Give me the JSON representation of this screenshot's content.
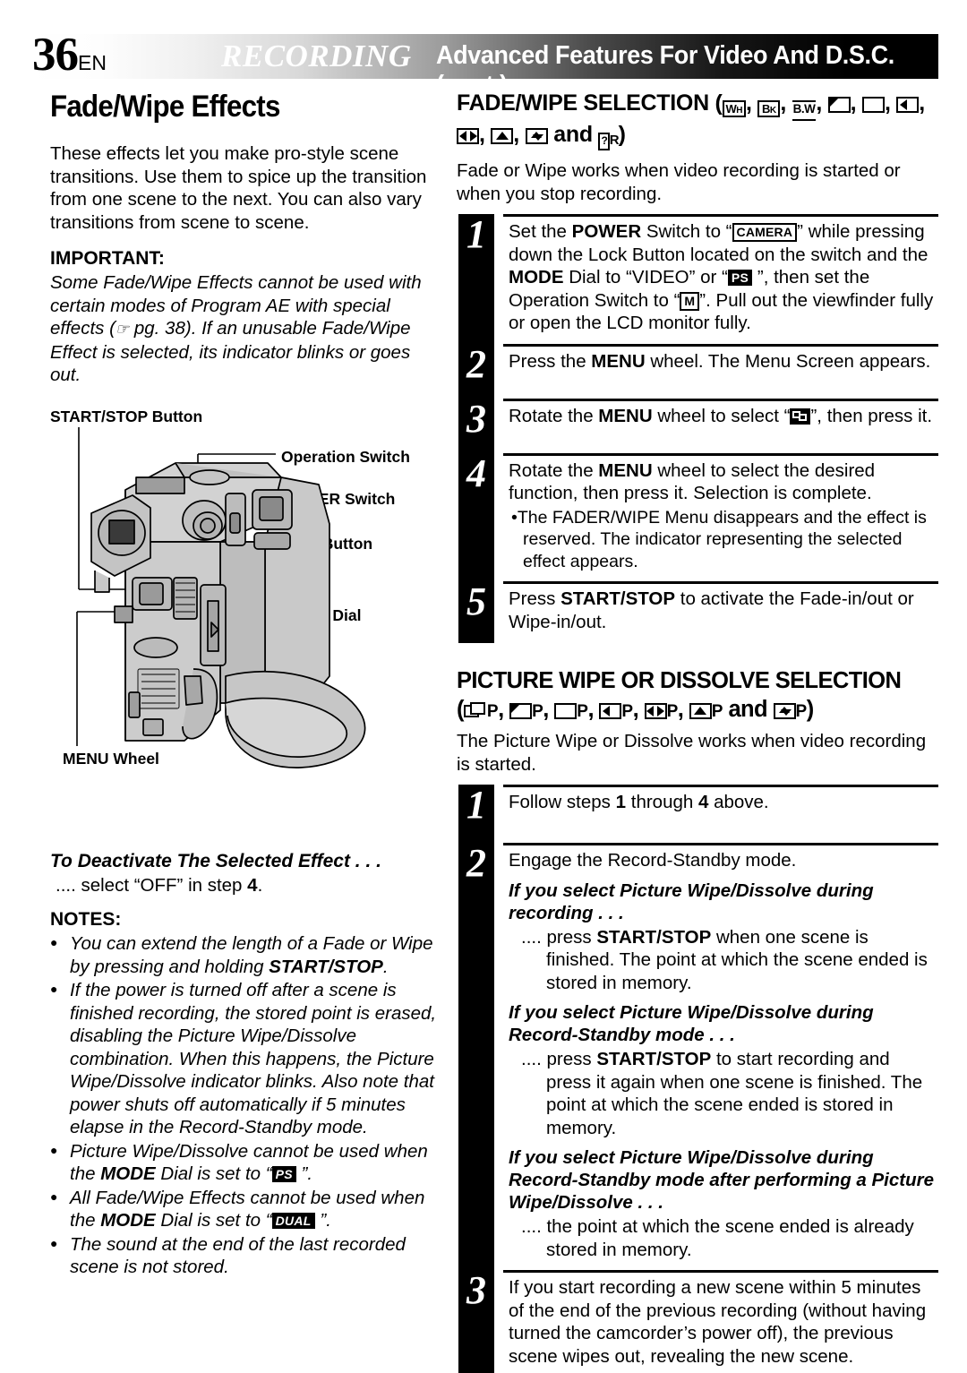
{
  "header": {
    "page_number": "36",
    "locale": "EN",
    "title_italic": "RECORDING",
    "title_rest": "Advanced Features For Video And D.S.C. (cont.)"
  },
  "left_column": {
    "section_title": "Fade/Wipe Effects",
    "intro": "These effects let you make pro-style scene transitions. Use them to spice up the transition from one scene to the next. You can also vary transitions from scene to scene.",
    "important_label": "IMPORTANT:",
    "important_text_1": "Some Fade/Wipe Effects cannot be used with certain modes of Program AE with special effects (",
    "important_pg": " pg. 38). If an unusable Fade/Wipe Effect is selected, its indicator blinks or goes out.",
    "diagram": {
      "labels": [
        "START/STOP Button",
        "Operation Switch",
        "POWER Switch",
        "Lock Button",
        "MODE Dial",
        "MENU Wheel"
      ]
    },
    "deactivate_head": "To Deactivate The Selected Effect . . .",
    "deactivate_text_a": ".... select “OFF” in step ",
    "deactivate_step": "4",
    "deactivate_text_b": ".",
    "notes_label": "NOTES:",
    "notes": [
      {
        "text_a": "You can extend the length of a Fade or Wipe by pressing and holding ",
        "bold": "START/STOP",
        "text_b": "."
      },
      {
        "text_a": "If the power is turned off after a scene is finished recording, the stored point is erased, disabling the Picture Wipe/Dissolve combination. When this happens, the Picture Wipe/Dissolve indicator blinks. Also note that power shuts off automatically if 5 minutes elapse in the Record-Standby mode.",
        "bold": "",
        "text_b": ""
      },
      {
        "text_a": "Picture Wipe/Dissolve cannot be used when the ",
        "bold": "MODE",
        "text_b": " Dial is set to “",
        "badge": "PS",
        "text_c": " ”."
      },
      {
        "text_a": "All Fade/Wipe Effects cannot be used when the ",
        "bold": "MODE",
        "text_b": " Dial is set to “",
        "badge": "DUAL",
        "text_c": " ”."
      },
      {
        "text_a": "The sound at the end of the last recorded scene is not stored.",
        "bold": "",
        "text_b": ""
      }
    ]
  },
  "right_column": {
    "fade_section": {
      "heading_text": "FADE/WIPE SELECTION",
      "icons_row1": [
        "WH",
        "BK",
        "B.W",
        "corner-wipe-icon"
      ],
      "icons_row2": [
        "window-wipe-icon",
        "slide-left-wipe-icon",
        "door-wipe-icon",
        "scroll-up-wipe-icon",
        "shutter-wipe-icon",
        "?R"
      ],
      "and_word": "and",
      "intro": "Fade or Wipe works when video recording is started or when you stop recording.",
      "steps": [
        {
          "num": "1",
          "segments": [
            {
              "t": "Set the "
            },
            {
              "t": "POWER",
              "s": "bold"
            },
            {
              "t": " Switch to “"
            },
            {
              "t": "CAMERA",
              "s": "badge-out"
            },
            {
              "t": "” while pressing down the Lock Button located on the switch and the "
            },
            {
              "t": "MODE",
              "s": "bold"
            },
            {
              "t": " Dial to “VIDEO” or “"
            },
            {
              "t": "PS",
              "s": "badge-fill"
            },
            {
              "t": " ”, then set the Operation Switch to “"
            },
            {
              "t": "M",
              "s": "badge-out"
            },
            {
              "t": "”. Pull out the viewfinder fully or open the LCD monitor fully."
            }
          ]
        },
        {
          "num": "2",
          "segments": [
            {
              "t": "Press the "
            },
            {
              "t": "MENU",
              "s": "bold"
            },
            {
              "t": " wheel. The Menu Screen appears."
            }
          ]
        },
        {
          "num": "3",
          "segments": [
            {
              "t": "Rotate the "
            },
            {
              "t": "MENU",
              "s": "bold"
            },
            {
              "t": " wheel to select “"
            },
            {
              "t": "menu-icon",
              "s": "badge-menu"
            },
            {
              "t": "”, then press it."
            }
          ]
        },
        {
          "num": "4",
          "segments": [
            {
              "t": "Rotate the "
            },
            {
              "t": "MENU",
              "s": "bold"
            },
            {
              "t": " wheel to select the desired function, then press it. Selection is complete."
            }
          ],
          "bullet": "The FADER/WIPE Menu disappears and the effect is reserved. The indicator representing the selected effect appears."
        },
        {
          "num": "5",
          "segments": [
            {
              "t": "Press "
            },
            {
              "t": "START/STOP",
              "s": "bold"
            },
            {
              "t": " to activate the Fade-in/out or Wipe-in/out."
            }
          ]
        }
      ]
    },
    "picture_section": {
      "heading_text": "PICTURE WIPE OR DISSOLVE SELECTION",
      "icons": [
        "dissolve-icon",
        "corner-wipe-icon",
        "window-wipe-icon",
        "slide-left-wipe-icon",
        "door-wipe-icon",
        "scroll-up-wipe-icon",
        "shutter-wipe-icon"
      ],
      "icon_suffix": "P",
      "and_word": "and",
      "intro": "The Picture Wipe or Dissolve works when video recording is started.",
      "steps": [
        {
          "num": "1",
          "segments": [
            {
              "t": "Follow steps "
            },
            {
              "t": "1",
              "s": "bold"
            },
            {
              "t": " through "
            },
            {
              "t": "4",
              "s": "bold"
            },
            {
              "t": " above."
            }
          ]
        },
        {
          "num": "2",
          "segments": [
            {
              "t": "Engage the Record-Standby mode."
            }
          ],
          "subsections": [
            {
              "head": "If you select Picture Wipe/Dissolve during recording . . .",
              "body_a": ".... press ",
              "bold": "START/STOP",
              "body_b": " when one scene is finished. The point at which the scene ended is stored in memory."
            },
            {
              "head": "If you select Picture Wipe/Dissolve during Record-Standby mode . . .",
              "body_a": ".... press ",
              "bold": "START/STOP",
              "body_b": " to start recording and press it again when one scene is finished. The point at which the scene ended is stored in memory."
            },
            {
              "head": "If you select Picture Wipe/Dissolve during Record-Standby mode after performing a Picture Wipe/Dissolve . . .",
              "body_a": ".... the point at which the scene ended is already stored in memory.",
              "bold": "",
              "body_b": ""
            }
          ]
        },
        {
          "num": "3",
          "segments": [
            {
              "t": "If you start recording a new scene within 5 minutes of the end of the previous recording (without having turned the camcorder’s power off), the previous scene wipes out, revealing the new scene."
            }
          ]
        }
      ]
    }
  }
}
